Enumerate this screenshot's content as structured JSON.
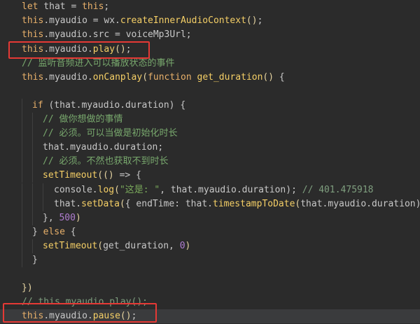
{
  "lines": [
    {
      "tokens": [
        {
          "c": "kw",
          "t": "let"
        },
        {
          "c": "var",
          "t": " that = "
        },
        {
          "c": "kw",
          "t": "this"
        },
        {
          "c": "punc",
          "t": ";"
        }
      ]
    },
    {
      "tokens": [
        {
          "c": "kw",
          "t": "this"
        },
        {
          "c": "prop",
          "t": ".myaudio = wx."
        },
        {
          "c": "fn",
          "t": "createInnerAudioContext"
        },
        {
          "c": "paren",
          "t": "()"
        },
        {
          "c": "punc",
          "t": ";"
        }
      ]
    },
    {
      "tokens": [
        {
          "c": "kw",
          "t": "this"
        },
        {
          "c": "prop",
          "t": ".myaudio.src = voiceMp3Url;"
        }
      ]
    },
    {
      "tokens": [
        {
          "c": "kw",
          "t": "this"
        },
        {
          "c": "prop",
          "t": ".myaudio."
        },
        {
          "c": "fn",
          "t": "play"
        },
        {
          "c": "paren",
          "t": "()"
        },
        {
          "c": "punc",
          "t": ";"
        }
      ]
    },
    {
      "tokens": [
        {
          "c": "cmt-cn",
          "t": "// 监听音频进入可以播放状态的事件"
        }
      ]
    },
    {
      "tokens": [
        {
          "c": "kw",
          "t": "this"
        },
        {
          "c": "prop",
          "t": ".myaudio."
        },
        {
          "c": "fn",
          "t": "onCanplay"
        },
        {
          "c": "paren",
          "t": "("
        },
        {
          "c": "kw",
          "t": "function"
        },
        {
          "c": "var",
          "t": " "
        },
        {
          "c": "fn",
          "t": "get_duration"
        },
        {
          "c": "paren",
          "t": "()"
        },
        {
          "c": "var",
          "t": " {"
        }
      ]
    },
    {
      "tokens": []
    },
    {
      "tokens": [
        {
          "c": "kw",
          "t": "if"
        },
        {
          "c": "var",
          "t": " (that.myaudio.duration) {"
        }
      ]
    },
    {
      "tokens": [
        {
          "c": "cmt-cn",
          "t": "// 做你想做的事情"
        }
      ]
    },
    {
      "tokens": [
        {
          "c": "cmt-cn",
          "t": "// 必须。可以当做是初始化时长"
        }
      ]
    },
    {
      "tokens": [
        {
          "c": "var",
          "t": "that.myaudio.duration;"
        }
      ]
    },
    {
      "tokens": [
        {
          "c": "cmt-cn",
          "t": "// 必须。不然也获取不到时长"
        }
      ]
    },
    {
      "tokens": [
        {
          "c": "fn",
          "t": "setTimeout"
        },
        {
          "c": "paren",
          "t": "("
        },
        {
          "c": "paren",
          "t": "()"
        },
        {
          "c": "var",
          "t": " => {"
        }
      ]
    },
    {
      "tokens": [
        {
          "c": "var",
          "t": "console."
        },
        {
          "c": "fn",
          "t": "log"
        },
        {
          "c": "paren",
          "t": "("
        },
        {
          "c": "str",
          "t": "\"这是: \""
        },
        {
          "c": "var",
          "t": ", that.myaudio.duration);"
        },
        {
          "c": "cmt",
          "t": " // 401.475918"
        }
      ]
    },
    {
      "tokens": [
        {
          "c": "var",
          "t": "that."
        },
        {
          "c": "fn",
          "t": "setData"
        },
        {
          "c": "paren",
          "t": "("
        },
        {
          "c": "var",
          "t": "{ endTime: that."
        },
        {
          "c": "fn",
          "t": "timestampToDate"
        },
        {
          "c": "paren",
          "t": "("
        },
        {
          "c": "var",
          "t": "that.myaudio.duration),"
        }
      ]
    },
    {
      "tokens": [
        {
          "c": "var",
          "t": "}, "
        },
        {
          "c": "num",
          "t": "500"
        },
        {
          "c": "paren",
          "t": ")"
        }
      ]
    },
    {
      "tokens": [
        {
          "c": "var",
          "t": "} "
        },
        {
          "c": "kw",
          "t": "else"
        },
        {
          "c": "var",
          "t": " {"
        }
      ]
    },
    {
      "tokens": [
        {
          "c": "fn",
          "t": "setTimeout"
        },
        {
          "c": "paren",
          "t": "("
        },
        {
          "c": "var",
          "t": "get_duration, "
        },
        {
          "c": "num",
          "t": "0"
        },
        {
          "c": "paren",
          "t": ")"
        }
      ]
    },
    {
      "tokens": [
        {
          "c": "var",
          "t": "}"
        }
      ]
    },
    {
      "tokens": []
    },
    {
      "tokens": [
        {
          "c": "paren",
          "t": "})"
        }
      ]
    },
    {
      "tokens": [
        {
          "c": "cmt",
          "t": "// this.myaudio.play();"
        }
      ]
    },
    {
      "tokens": [
        {
          "c": "kw",
          "t": "this"
        },
        {
          "c": "prop",
          "t": ".myaudio."
        },
        {
          "c": "fn",
          "t": "pause"
        },
        {
          "c": "paren",
          "t": "()"
        },
        {
          "c": "punc",
          "t": ";"
        }
      ]
    }
  ],
  "highlight_color": "#e53935"
}
